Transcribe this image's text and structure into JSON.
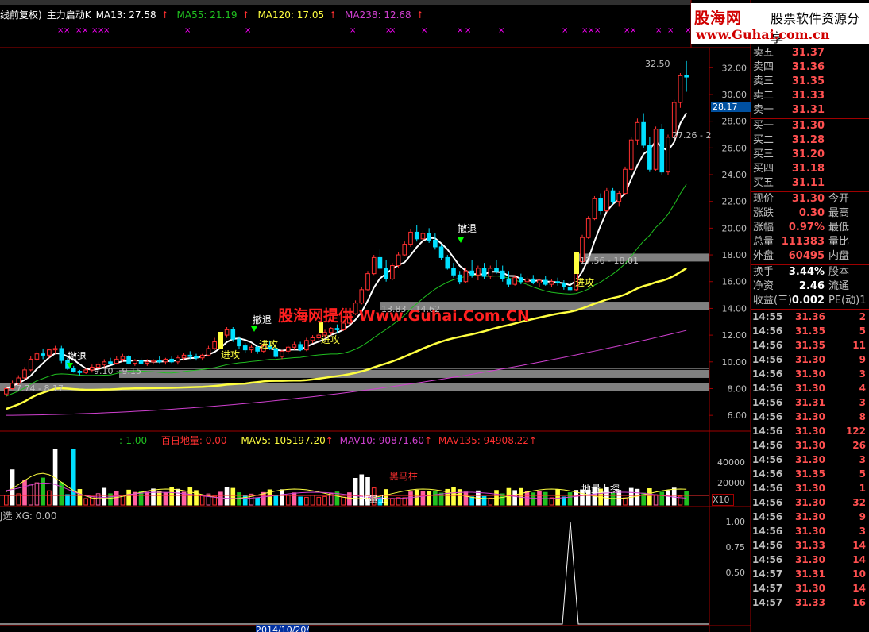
{
  "indicator_line": {
    "mode": "线前复权)",
    "name": "主力启动K",
    "ma13": "MA13: 27.58",
    "ma55": "MA55: 21.19",
    "ma120": "MA120: 17.05",
    "ma238": "MA238: 12.68"
  },
  "watermark": "股海网提供 Www.Guhai.Com.CN",
  "logo": {
    "brand": "股海网",
    "slogan": "股票软件资源分享",
    "url": "www.Guhai.com.cn"
  },
  "price_axis": [
    "32.00",
    "30.00",
    "28.00",
    "26.00",
    "24.00",
    "22.00",
    "20.00",
    "18.00",
    "16.00",
    "14.00",
    "12.00",
    "10.00",
    "8.00",
    "6.00"
  ],
  "price_marker": "28.17",
  "chart_labels": {
    "high_label": "32.50",
    "range_top": "27.26 - 2",
    "range_1756": "17.56 - 18.01",
    "range_1383": "13.83 - 14.62",
    "range_910": "9.10 - 9.15",
    "range_774": "7.74 - 8.17",
    "withdraw": "撤退",
    "attack": "进攻"
  },
  "volume_pane": {
    "ratio": ":-1.00",
    "bai_ri": "百日地量: 0.00",
    "mav5": "MAV5: 105197.20",
    "mav10": "MAV10: 90871.60",
    "mav135": "MAV135: 94908.22",
    "axis": [
      "40000",
      "20000"
    ],
    "unit": "X10",
    "label_black_horse": "黑马柱",
    "label_probe": "地量上探",
    "label_ground": "地量上"
  },
  "xg_pane": {
    "label": "J选 XG: 0.00",
    "axis": [
      "1.00",
      "0.75",
      "0.50"
    ]
  },
  "date_label": "2014/10/20/",
  "quote": {
    "asks": [
      {
        "label": "卖五",
        "price": "31.37"
      },
      {
        "label": "卖四",
        "price": "31.36"
      },
      {
        "label": "卖三",
        "price": "31.35"
      },
      {
        "label": "卖二",
        "price": "31.33"
      },
      {
        "label": "卖一",
        "price": "31.31"
      }
    ],
    "bids": [
      {
        "label": "买一",
        "price": "31.30"
      },
      {
        "label": "买二",
        "price": "31.28"
      },
      {
        "label": "买三",
        "price": "31.20"
      },
      {
        "label": "买四",
        "price": "31.18"
      },
      {
        "label": "买五",
        "price": "31.11"
      }
    ],
    "stats1": [
      {
        "label": "现价",
        "value": "31.30",
        "right": "今开"
      },
      {
        "label": "涨跌",
        "value": "0.30",
        "right": "最高"
      },
      {
        "label": "涨幅",
        "value": "0.97%",
        "right": "最低"
      },
      {
        "label": "总量",
        "value": "111383",
        "right": "量比"
      },
      {
        "label": "外盘",
        "value": "60495",
        "right": "内盘"
      }
    ],
    "stats2": [
      {
        "label": "换手",
        "value": "3.44%",
        "right": "股本"
      },
      {
        "label": "净资",
        "value": "2.46",
        "right": "流通"
      },
      {
        "label": "收益(三)",
        "value": "0.002",
        "right": "PE(动)1"
      }
    ]
  },
  "ticks": [
    {
      "t": "14:55",
      "p": "31.36",
      "v": "2"
    },
    {
      "t": "14:56",
      "p": "31.35",
      "v": "5"
    },
    {
      "t": "14:56",
      "p": "31.35",
      "v": "11"
    },
    {
      "t": "14:56",
      "p": "31.30",
      "v": "9"
    },
    {
      "t": "14:56",
      "p": "31.30",
      "v": "3"
    },
    {
      "t": "14:56",
      "p": "31.30",
      "v": "4"
    },
    {
      "t": "14:56",
      "p": "31.31",
      "v": "3"
    },
    {
      "t": "14:56",
      "p": "31.30",
      "v": "8"
    },
    {
      "t": "14:56",
      "p": "31.30",
      "v": "122"
    },
    {
      "t": "14:56",
      "p": "31.30",
      "v": "26"
    },
    {
      "t": "14:56",
      "p": "31.30",
      "v": "3"
    },
    {
      "t": "14:56",
      "p": "31.35",
      "v": "5"
    },
    {
      "t": "14:56",
      "p": "31.30",
      "v": "1"
    },
    {
      "t": "14:56",
      "p": "31.30",
      "v": "32"
    },
    {
      "t": "14:56",
      "p": "31.30",
      "v": "9"
    },
    {
      "t": "14:56",
      "p": "31.30",
      "v": "3"
    },
    {
      "t": "14:56",
      "p": "31.33",
      "v": "14"
    },
    {
      "t": "14:56",
      "p": "31.30",
      "v": "14"
    },
    {
      "t": "14:57",
      "p": "31.31",
      "v": "10"
    },
    {
      "t": "14:57",
      "p": "31.30",
      "v": "14"
    },
    {
      "t": "14:57",
      "p": "31.33",
      "v": "16"
    }
  ],
  "colors": {
    "up": "#ff3030",
    "down": "#00e0ff",
    "ma13": "#ffffff",
    "ma55": "#20c020",
    "ma120": "#ffff40",
    "ma238": "#d040d0",
    "signal": "#ff00ff",
    "band": "#808080"
  },
  "chart_data": {
    "type": "candlestick",
    "ylim": [
      5.0,
      33.5
    ],
    "ohlc": [
      [
        7.6,
        8.2,
        7.4,
        8.0
      ],
      [
        8.0,
        8.6,
        7.9,
        8.4
      ],
      [
        8.4,
        9.0,
        8.2,
        8.8
      ],
      [
        8.8,
        9.6,
        8.7,
        9.4
      ],
      [
        9.4,
        10.4,
        9.3,
        10.2
      ],
      [
        10.2,
        10.8,
        10.0,
        10.6
      ],
      [
        10.6,
        11.0,
        10.2,
        10.5
      ],
      [
        10.5,
        11.0,
        10.3,
        10.9
      ],
      [
        10.9,
        11.2,
        10.6,
        11.0
      ],
      [
        11.0,
        11.2,
        9.9,
        10.1
      ],
      [
        10.1,
        10.3,
        9.4,
        9.5
      ],
      [
        9.5,
        9.7,
        9.2,
        9.3
      ],
      [
        9.3,
        9.4,
        9.0,
        9.2
      ],
      [
        9.2,
        9.5,
        9.1,
        9.4
      ],
      [
        9.4,
        9.8,
        9.2,
        9.6
      ],
      [
        9.6,
        10.0,
        9.4,
        9.8
      ],
      [
        9.8,
        10.2,
        9.6,
        10.0
      ],
      [
        10.0,
        10.3,
        9.8,
        9.9
      ],
      [
        9.9,
        10.4,
        9.8,
        10.2
      ],
      [
        10.2,
        10.6,
        10.0,
        10.4
      ],
      [
        10.4,
        10.5,
        9.8,
        9.9
      ],
      [
        9.9,
        10.2,
        9.7,
        10.1
      ],
      [
        10.1,
        10.3,
        9.8,
        9.9
      ],
      [
        9.9,
        10.2,
        9.7,
        10.0
      ],
      [
        10.0,
        10.2,
        9.8,
        10.1
      ],
      [
        10.1,
        10.4,
        9.9,
        10.0
      ],
      [
        10.0,
        10.3,
        9.8,
        10.2
      ],
      [
        10.2,
        10.4,
        9.9,
        10.0
      ],
      [
        10.0,
        10.5,
        9.8,
        10.3
      ],
      [
        10.3,
        10.7,
        10.1,
        10.5
      ],
      [
        10.5,
        10.8,
        10.2,
        10.4
      ],
      [
        10.4,
        10.6,
        10.1,
        10.3
      ],
      [
        10.3,
        10.6,
        10.1,
        10.5
      ],
      [
        10.5,
        11.2,
        10.4,
        11.0
      ],
      [
        11.0,
        11.8,
        10.9,
        11.5
      ],
      [
        11.5,
        12.2,
        11.3,
        12.0
      ],
      [
        12.0,
        12.6,
        11.8,
        12.4
      ],
      [
        12.4,
        12.6,
        11.5,
        11.7
      ],
      [
        11.7,
        11.9,
        11.0,
        11.2
      ],
      [
        11.2,
        11.4,
        10.7,
        10.9
      ],
      [
        10.9,
        11.3,
        10.7,
        11.1
      ],
      [
        11.1,
        11.2,
        10.6,
        10.8
      ],
      [
        10.8,
        11.4,
        10.7,
        11.2
      ],
      [
        11.2,
        11.6,
        10.9,
        11.0
      ],
      [
        11.0,
        11.2,
        10.3,
        10.4
      ],
      [
        10.4,
        10.9,
        10.2,
        10.8
      ],
      [
        10.8,
        11.2,
        10.6,
        11.1
      ],
      [
        11.1,
        11.5,
        10.9,
        11.3
      ],
      [
        11.3,
        11.5,
        10.8,
        10.9
      ],
      [
        10.9,
        11.8,
        10.8,
        11.6
      ],
      [
        11.6,
        12.0,
        11.4,
        11.8
      ],
      [
        11.8,
        12.2,
        11.6,
        12.0
      ],
      [
        12.0,
        12.4,
        11.8,
        12.2
      ],
      [
        12.2,
        12.6,
        12.0,
        12.5
      ],
      [
        12.5,
        12.8,
        12.2,
        12.4
      ],
      [
        12.4,
        13.0,
        12.3,
        12.9
      ],
      [
        12.9,
        13.8,
        12.8,
        13.6
      ],
      [
        13.6,
        14.6,
        13.5,
        14.4
      ],
      [
        14.4,
        15.6,
        14.3,
        15.4
      ],
      [
        15.4,
        16.8,
        15.3,
        16.6
      ],
      [
        16.6,
        18.0,
        16.5,
        17.8
      ],
      [
        17.8,
        18.4,
        16.9,
        17.0
      ],
      [
        17.0,
        17.6,
        16.0,
        16.2
      ],
      [
        16.2,
        17.4,
        16.1,
        17.2
      ],
      [
        17.2,
        18.2,
        17.0,
        18.0
      ],
      [
        18.0,
        19.0,
        17.9,
        18.8
      ],
      [
        18.8,
        19.9,
        18.6,
        19.7
      ],
      [
        19.7,
        20.2,
        19.0,
        19.2
      ],
      [
        19.2,
        19.8,
        18.8,
        19.6
      ],
      [
        19.6,
        20.0,
        18.9,
        19.1
      ],
      [
        19.1,
        19.6,
        18.4,
        18.6
      ],
      [
        18.6,
        18.8,
        17.6,
        17.8
      ],
      [
        17.8,
        18.0,
        16.9,
        17.0
      ],
      [
        17.0,
        17.4,
        16.3,
        16.5
      ],
      [
        16.5,
        16.8,
        15.8,
        16.0
      ],
      [
        16.0,
        17.0,
        15.9,
        16.8
      ],
      [
        16.8,
        17.6,
        16.3,
        16.5
      ],
      [
        16.5,
        17.2,
        16.1,
        17.0
      ],
      [
        17.0,
        17.4,
        16.2,
        16.4
      ],
      [
        16.4,
        17.2,
        16.2,
        17.0
      ],
      [
        17.0,
        17.6,
        16.6,
        16.8
      ],
      [
        16.8,
        17.2,
        16.0,
        16.2
      ],
      [
        16.2,
        16.8,
        15.6,
        15.8
      ],
      [
        15.8,
        16.5,
        15.7,
        16.3
      ],
      [
        16.3,
        16.6,
        15.8,
        16.0
      ],
      [
        16.0,
        16.4,
        15.7,
        16.2
      ],
      [
        16.2,
        16.5,
        15.8,
        15.9
      ],
      [
        15.9,
        16.2,
        15.6,
        16.1
      ],
      [
        16.1,
        16.4,
        15.7,
        15.8
      ],
      [
        15.8,
        16.2,
        15.6,
        16.0
      ],
      [
        16.0,
        16.3,
        15.7,
        15.9
      ],
      [
        15.9,
        16.1,
        15.4,
        15.6
      ],
      [
        15.6,
        16.0,
        15.2,
        15.4
      ],
      [
        15.4,
        17.6,
        15.3,
        17.5
      ],
      [
        17.5,
        19.5,
        17.4,
        19.3
      ],
      [
        19.3,
        20.9,
        19.2,
        20.7
      ],
      [
        20.7,
        22.4,
        20.6,
        22.2
      ],
      [
        22.2,
        22.6,
        21.0,
        21.3
      ],
      [
        21.3,
        23.0,
        21.2,
        22.8
      ],
      [
        22.8,
        23.0,
        21.8,
        22.0
      ],
      [
        22.0,
        22.8,
        21.6,
        22.6
      ],
      [
        22.6,
        24.6,
        22.5,
        24.4
      ],
      [
        24.4,
        26.8,
        24.3,
        26.6
      ],
      [
        26.6,
        28.2,
        26.2,
        27.9
      ],
      [
        27.9,
        28.6,
        26.0,
        26.2
      ],
      [
        26.2,
        26.8,
        24.2,
        24.4
      ],
      [
        24.4,
        27.6,
        24.3,
        27.4
      ],
      [
        27.4,
        27.8,
        24.0,
        24.2
      ],
      [
        24.2,
        27.0,
        24.0,
        26.8
      ],
      [
        26.8,
        29.6,
        26.6,
        29.4
      ],
      [
        29.4,
        31.6,
        29.0,
        31.4
      ],
      [
        31.4,
        32.5,
        30.2,
        31.3
      ]
    ]
  }
}
